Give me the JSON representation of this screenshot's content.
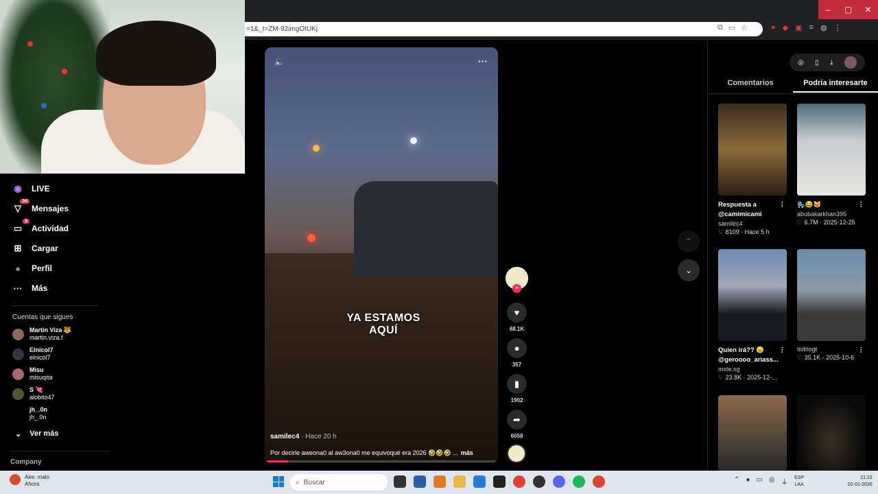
{
  "browser": {
    "url": "=1&_t=ZM-92imgOtUKj",
    "window_controls": {
      "minimize": "–",
      "maximize": "▢",
      "close": "✕"
    }
  },
  "sidebar": {
    "nav": [
      {
        "label": "LIVE",
        "icon": "live-icon",
        "glyph": "◉"
      },
      {
        "label": "Mensajes",
        "icon": "messages-icon",
        "glyph": "▽",
        "badge": "34"
      },
      {
        "label": "Actividad",
        "icon": "activity-icon",
        "glyph": "▭",
        "badge": "3"
      },
      {
        "label": "Cargar",
        "icon": "upload-icon",
        "glyph": "⊞"
      },
      {
        "label": "Perfil",
        "icon": "profile-icon",
        "glyph": "●"
      },
      {
        "label": "Más",
        "icon": "more-icon",
        "glyph": "···"
      }
    ],
    "following_title": "Cuentas que sigues",
    "following": [
      {
        "name": "Martín Viza",
        "emoji": "🐯",
        "handle": "martin.viza.f"
      },
      {
        "name": "Elnicol7",
        "emoji": "",
        "handle": "elnicol7"
      },
      {
        "name": "Misu",
        "emoji": "",
        "handle": "misuqita"
      },
      {
        "name": "S",
        "emoji": "💘",
        "handle": "alobito47"
      },
      {
        "name": "jh_.0n",
        "emoji": "",
        "handle": "jh_.0n"
      }
    ],
    "see_more": "Ver más",
    "see_more_icon": "⌄",
    "company": "Company"
  },
  "video": {
    "caption": "YA ESTAMOS AQUÍ",
    "username": "samilec4",
    "time": "· Hace 20 h",
    "description": "Por decirle aweona0 al aw3ona0 me equivoqué era 2026 🤣🤣🤣 ...",
    "more": "más",
    "mute_glyph": "🔈",
    "menu_glyph": "···",
    "progress": 0.1
  },
  "actions": {
    "likes": "68.1K",
    "comments": "357",
    "saves": "1902",
    "shares": "6058",
    "follow_glyph": "+"
  },
  "panel": {
    "tabs": {
      "comments": "Comentarios",
      "suggested": "Podría interesarte"
    },
    "toolbar": {
      "compass": "◎",
      "phone": "▯",
      "download": "⤓"
    },
    "cards": [
      {
        "title": "Respuesta a @camimicami",
        "author": "samilec4",
        "stats": "♡ 8109 · Hace 5 h"
      },
      {
        "title": "🛼😂🐱",
        "author": "abubakarkhan395",
        "stats": "♡ 6.7M · 2025-12-25"
      },
      {
        "title": "Quien irá?? 😠 @geroooo_ariass...",
        "author": "mxte.sg",
        "stats": "♡ 23.8K · 2025-12-..."
      },
      {
        "title": "",
        "author": "tiotitogt",
        "stats": "♡ 35.1K · 2025-10-6"
      },
      {
        "title": "",
        "author": "",
        "stats": ""
      },
      {
        "title": "",
        "author": "",
        "stats": ""
      }
    ]
  },
  "nav_arrows": {
    "up": "⌃",
    "down": "⌄"
  },
  "taskbar": {
    "weather_title": "Aire: malo",
    "weather_sub": "Ahora",
    "search_placeholder": "Buscar",
    "lang_top": "ESP",
    "lang_bottom": "LAA",
    "time": "21:22",
    "date": "01-01-2026"
  },
  "colors": {
    "accent": "#fe2c55",
    "taskbar": "#dfe6ee",
    "close": "#c42b3c"
  }
}
